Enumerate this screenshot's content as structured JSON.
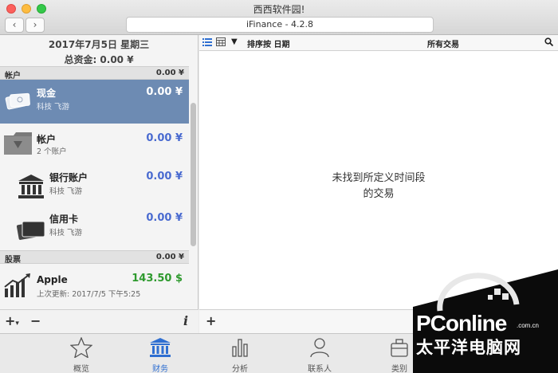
{
  "window": {
    "title": "西西软件园!",
    "address": "iFinance - 4.2.8",
    "back": "‹",
    "forward": "›"
  },
  "summary": {
    "date": "2017年7月5日 星期三",
    "total": "总资金: 0.00 ¥"
  },
  "sections": {
    "accounts": {
      "label": "帐户",
      "amount": "0.00 ¥"
    },
    "stocks": {
      "label": "股票",
      "amount": "0.00 ¥"
    }
  },
  "accounts": [
    {
      "name": "现金",
      "sub": "科技 飞游",
      "value": "0.00 ¥",
      "icon": "cash-icon"
    },
    {
      "name": "帐户",
      "sub": "2 个账户",
      "value": "0.00 ¥",
      "icon": "folder-icon"
    },
    {
      "name": "银行账户",
      "sub": "科技 飞游",
      "value": "0.00 ¥",
      "icon": "bank-icon"
    },
    {
      "name": "信用卡",
      "sub": "科技 飞游",
      "value": "0.00 ¥",
      "icon": "cards-icon"
    }
  ],
  "stock": {
    "name": "Apple",
    "value": "143.50 $",
    "updated": "上次更新: 2017/7/5 下午5:25",
    "icon": "chart-up-icon"
  },
  "left_footer": {
    "add": "+",
    "add_arrow": "▾",
    "remove": "−",
    "info": "i"
  },
  "toolbar": {
    "sort_label": "排序按 日期",
    "filter_label": "所有交易"
  },
  "empty_message": {
    "line1": "未找到所定义时间段",
    "line2": "的交易"
  },
  "right_footer": {
    "add": "+"
  },
  "tabs": [
    {
      "label": "概览",
      "icon": "star-icon"
    },
    {
      "label": "财务",
      "icon": "bank-icon"
    },
    {
      "label": "分析",
      "icon": "bar-chart-icon"
    },
    {
      "label": "联系人",
      "icon": "person-icon"
    },
    {
      "label": "类别",
      "icon": "category-icon"
    }
  ],
  "watermark": {
    "brand": "PConline",
    "domain": ".com.cn",
    "cn": "太平洋电脑网"
  },
  "colors": {
    "selection": "#6d8bb3",
    "amount_blue": "#4a6bd0",
    "stock_green": "#2e9a2e",
    "tab_active": "#2f6fd1"
  }
}
